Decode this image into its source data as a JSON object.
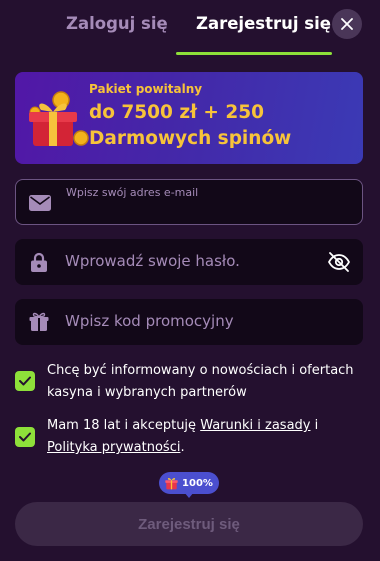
{
  "tabs": {
    "login": "Zaloguj się",
    "register": "Zarejestruj się",
    "active": "register"
  },
  "close_icon": "close-icon",
  "banner": {
    "eyebrow": "Pakiet powitalny",
    "headline": "do 7500 zł + 250 Darmowych spinów",
    "image": "gift-coins-icon"
  },
  "fields": {
    "email": {
      "label": "Wpisz swój adres e-mail",
      "icon": "envelope-icon"
    },
    "password": {
      "placeholder": "Wprowadź swoje hasło.",
      "icon": "lock-icon",
      "toggle_icon": "eye-off-icon"
    },
    "promo": {
      "placeholder": "Wpisz kod promocyjny",
      "icon": "gift-icon"
    }
  },
  "consents": {
    "marketing": {
      "text": "Chcę być informowany o nowościach i ofertach kasyna i wybranych partnerów",
      "checked": true
    },
    "terms": {
      "prefix": "Mam 18 lat i akceptuję ",
      "terms_link": "Warunki i zasady",
      "middle": " i ",
      "privacy_link": "Polityka prywatności",
      "suffix": ".",
      "checked": true
    }
  },
  "progress": {
    "label": "100%",
    "value": 100,
    "icon": "gift-icon"
  },
  "submit": {
    "label": "Zarejestruj się",
    "enabled": false
  },
  "colors": {
    "background": "#24102f",
    "accent_green": "#8ee03a",
    "banner_text": "#f7c33a",
    "input_bg": "#120818",
    "muted_text": "#a58bb8"
  }
}
